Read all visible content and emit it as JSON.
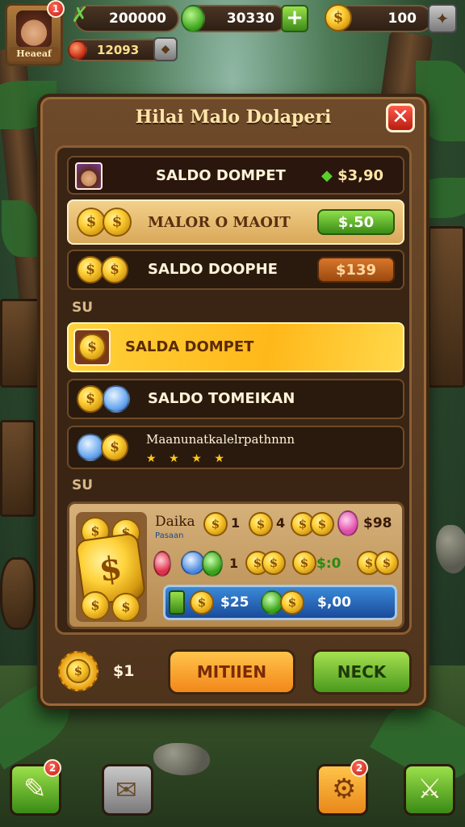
{
  "player": {
    "name": "Heaeaf",
    "notifications": "1"
  },
  "resources": {
    "xp": "200000",
    "gems": "30330",
    "coins": "100",
    "sub": "12093"
  },
  "modal": {
    "title": "Hilai Malo Dolaperi",
    "close_label": "✕",
    "rows": [
      {
        "label": "SALDO DOMPET",
        "value": "$3,90"
      },
      {
        "label": "MALOR O MAOIT",
        "value": "$.50"
      },
      {
        "label": "SALDO DOOPHE",
        "value": "$139"
      }
    ],
    "section_1": "SU",
    "rows_2": [
      {
        "label": "SALDA DOMPET"
      },
      {
        "label": "SALDO TOMEIKAN"
      },
      {
        "label": "Maanunatkalelrpathnnn",
        "stars": [
          "★",
          "★",
          "★",
          "★"
        ]
      }
    ],
    "section_2": "SU",
    "reward": {
      "title": "Daika",
      "subtitle": "Pasaan",
      "row1_vals": [
        "1",
        "4"
      ],
      "row1_price": "$98",
      "row2_vals": [
        "1"
      ],
      "row2_price": "$:0",
      "bar_price_1": "$25",
      "bar_price_2": "$,00"
    },
    "footer": {
      "coin_value": "$1",
      "primary_button": "MITIIEN",
      "secondary_button": "NECK"
    }
  },
  "bottom_bar": {
    "badge_left": "2",
    "badge_right": "2"
  },
  "colors": {
    "accent_green": "#4a9a1e",
    "accent_orange": "#f2871a",
    "gold": "#ffd23a",
    "panel_brown": "#4e331c"
  }
}
